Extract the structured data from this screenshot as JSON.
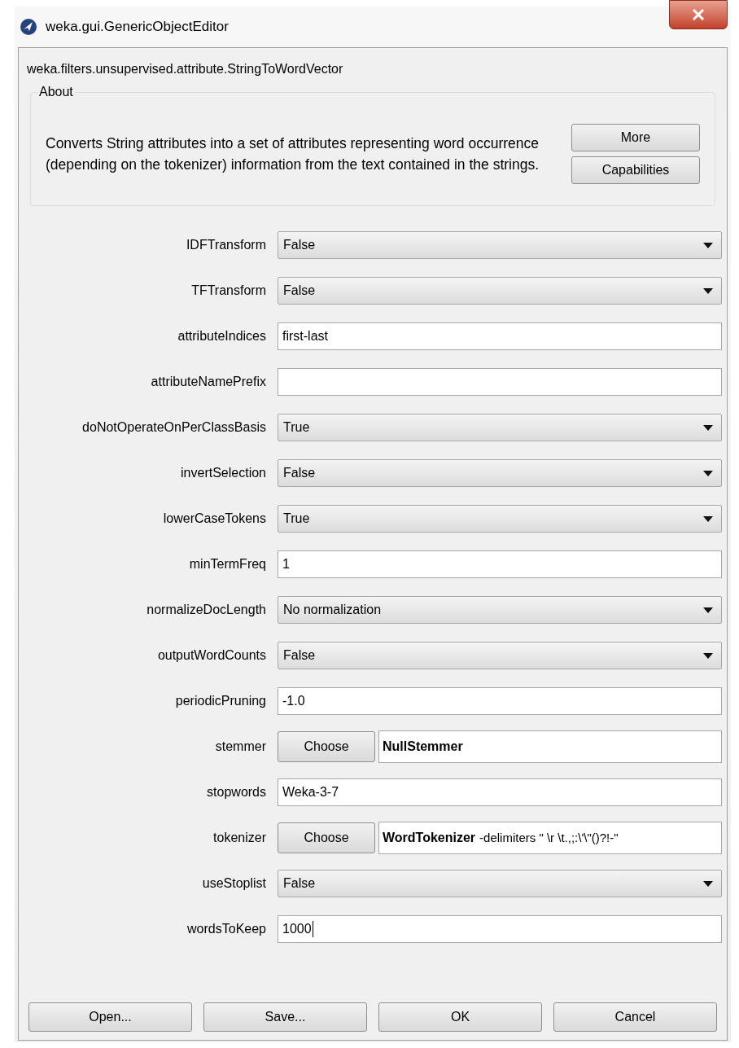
{
  "window": {
    "title": "weka.gui.GenericObjectEditor"
  },
  "class_name": "weka.filters.unsupervised.attribute.StringToWordVector",
  "about": {
    "title": "About",
    "text": "Converts String attributes into a set of attributes representing word occurrence (depending on the tokenizer) information from the text contained in the strings.",
    "buttons": [
      "More",
      "Capabilities"
    ]
  },
  "properties": [
    {
      "kind": "dropdown",
      "label": "IDFTransform",
      "value": "False"
    },
    {
      "kind": "dropdown",
      "label": "TFTransform",
      "value": "False"
    },
    {
      "kind": "text",
      "label": "attributeIndices",
      "value": "first-last"
    },
    {
      "kind": "text",
      "label": "attributeNamePrefix"
    },
    {
      "kind": "dropdown",
      "label": "doNotOperateOnPerClassBasis",
      "value": "True"
    },
    {
      "kind": "dropdown",
      "label": "invertSelection",
      "value": "False"
    },
    {
      "kind": "dropdown",
      "label": "lowerCaseTokens",
      "value": "True"
    },
    {
      "kind": "text",
      "label": "minTermFreq",
      "value": "1"
    },
    {
      "kind": "dropdown",
      "label": "normalizeDocLength",
      "value": "No normalization"
    },
    {
      "kind": "dropdown",
      "label": "outputWordCounts",
      "value": "False"
    },
    {
      "kind": "text",
      "label": "periodicPruning",
      "value": "-1.0"
    },
    {
      "kind": "chooser",
      "label": "stemmer",
      "button": "Choose",
      "name": "NullStemmer"
    },
    {
      "kind": "text",
      "label": "stopwords",
      "value": "Weka-3-7"
    },
    {
      "kind": "chooser",
      "label": "tokenizer",
      "button": "Choose",
      "name": "WordTokenizer",
      "options": "-delimiters \" \\r \\t.,;:\\'\\\"()?!-\""
    },
    {
      "kind": "dropdown",
      "label": "useStoplist",
      "value": "False"
    },
    {
      "kind": "text",
      "label": "wordsToKeep",
      "value": "1000",
      "focused": true
    }
  ],
  "buttons": [
    "Open...",
    "Save...",
    "OK",
    "Cancel"
  ]
}
